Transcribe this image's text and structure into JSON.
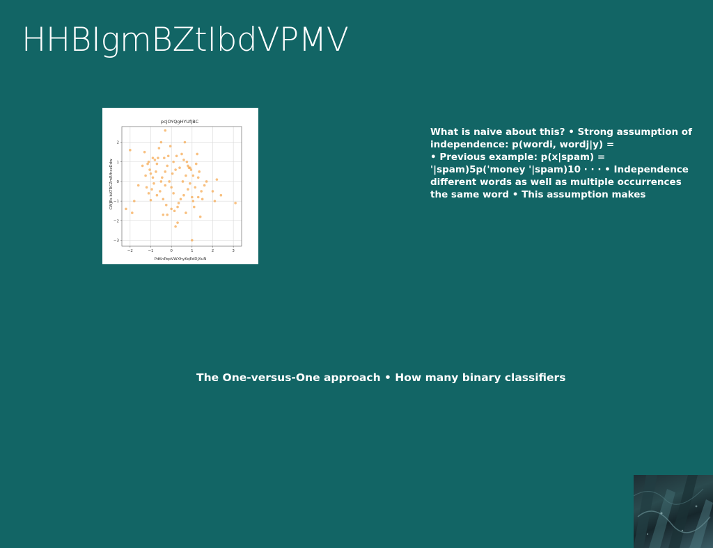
{
  "slide": {
    "title": "HHBIgmBZtIbdVPMV",
    "background": "#126565"
  },
  "body_lines": [
    "What is naive about this? • Strong assumption of",
    "independence: p(wordi, wordj|y) =",
    "• Previous example: p(x|spam) =",
    "'|spam)5p('money '|spam)10 · · · • Independence",
    "different words as well as multiple occurrences",
    "the same word • This assumption makes"
  ],
  "caption": "The One-versus-One approach • How many binary classifiers",
  "photo": {
    "icon": "foliage-photo"
  },
  "chart_data": {
    "type": "scatter",
    "title": "pcJOYQgHYUfJBC",
    "xlabel": "PdKnPepVWXhyKqEdDjXuN",
    "ylabel": "CWJEs bATRCZmRfhxzDdw",
    "xlim": [
      -2.4,
      3.4
    ],
    "ylim": [
      -3.3,
      2.8
    ],
    "xticks": [
      -2,
      -1,
      0,
      1,
      2,
      3
    ],
    "yticks": [
      -3,
      -2,
      -1,
      0,
      1,
      2
    ],
    "tick_labels_x": [
      "−2",
      "−1",
      "0",
      "1",
      "2",
      "3"
    ],
    "tick_labels_y": [
      "−3",
      "−2",
      "−1",
      "0",
      "1",
      "2"
    ],
    "grid": true,
    "marker_color": "#f5a54a",
    "x": [
      -2.2,
      -2.0,
      -1.9,
      -1.8,
      -1.6,
      -1.4,
      -1.3,
      -1.25,
      -1.2,
      -1.15,
      -1.1,
      -1.1,
      -1.05,
      -1.0,
      -0.95,
      -0.9,
      -0.9,
      -0.85,
      -0.8,
      -0.75,
      -0.7,
      -0.65,
      -0.6,
      -0.55,
      -0.5,
      -0.5,
      -0.45,
      -0.4,
      -0.35,
      -0.3,
      -0.3,
      -0.25,
      -0.2,
      -0.2,
      -0.15,
      -0.1,
      -0.05,
      0.0,
      0.05,
      0.1,
      0.1,
      0.15,
      0.2,
      0.25,
      0.3,
      0.35,
      0.4,
      0.45,
      0.5,
      0.55,
      0.6,
      0.65,
      0.7,
      0.7,
      0.75,
      0.8,
      0.85,
      0.9,
      0.95,
      1.0,
      1.0,
      1.05,
      1.1,
      1.15,
      1.2,
      1.25,
      1.3,
      1.35,
      1.4,
      1.45,
      1.5,
      1.6,
      1.7,
      2.0,
      2.1,
      2.2,
      2.4,
      3.1,
      -0.3,
      0.3,
      0.8,
      -0.7,
      0.0,
      1.05,
      0.6,
      -1.0,
      0.2,
      1.3,
      -0.4,
      0.9
    ],
    "y": [
      -1.4,
      1.6,
      -1.6,
      -1.0,
      -0.2,
      0.8,
      1.5,
      0.3,
      -0.3,
      0.9,
      -0.6,
      1.0,
      0.6,
      -0.95,
      -0.4,
      0.2,
      1.2,
      -0.1,
      1.1,
      0.5,
      -0.7,
      1.2,
      1.7,
      -0.5,
      0.0,
      2.0,
      0.2,
      -1.7,
      1.2,
      2.6,
      -0.2,
      -1.2,
      -1.7,
      0.8,
      1.3,
      0.0,
      1.8,
      -1.4,
      0.4,
      -0.6,
      1.0,
      -1.5,
      0.6,
      1.3,
      -2.1,
      -1.1,
      0.7,
      -0.9,
      1.4,
      0.0,
      -0.7,
      2.0,
      0.3,
      -1.6,
      1.0,
      -0.4,
      0.7,
      -0.1,
      0.6,
      -0.8,
      -3.0,
      0.3,
      -1.3,
      -0.3,
      0.9,
      1.4,
      -0.8,
      0.5,
      -1.8,
      -0.5,
      -0.9,
      -0.2,
      0.0,
      -0.5,
      -1.0,
      0.1,
      -0.7,
      -1.1,
      0.5,
      -1.3,
      0.8,
      0.9,
      -0.3,
      -1.0,
      1.1,
      0.4,
      -2.3,
      0.2,
      -0.9,
      0.7
    ]
  }
}
